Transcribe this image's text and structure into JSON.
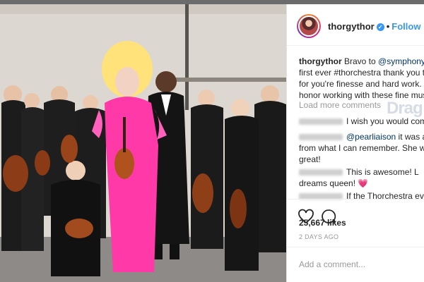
{
  "post": {
    "username": "thorgythor",
    "follow_label": "Follow",
    "caption": {
      "user": "thorgythor",
      "text_1": "Bravo to",
      "mention": "@symphonyns",
      "line_2": "first ever #thorchestra thank you to",
      "line_3": "for you're finesse and hard work. W",
      "line_4": "honor working with these fine musi"
    },
    "load_more": "Load more comments",
    "watermark": "Drag",
    "comments": [
      {
        "text": "I wish you would come to C"
      },
      {
        "mention": "@pearliaison",
        "text": " it was a p"
      },
      {
        "text": "from what I can remember. She wa"
      },
      {
        "text": "great!"
      },
      {
        "text": "This is awesome! L"
      },
      {
        "text": "dreams queen! ",
        "emoji": "💗"
      },
      {
        "text": "If the Thorchestra ever com"
      }
    ],
    "likes": "25,667 likes",
    "time_ago": "2 DAYS AGO",
    "add_comment_placeholder": "Add a comment..."
  },
  "icons": {
    "like": "heart-icon",
    "comment": "comment-bubble-icon",
    "verified": "verified-badge-icon"
  },
  "colors": {
    "accent": "#3897f0",
    "dress": "#ff3aa8",
    "wig": "#ffe27a"
  }
}
